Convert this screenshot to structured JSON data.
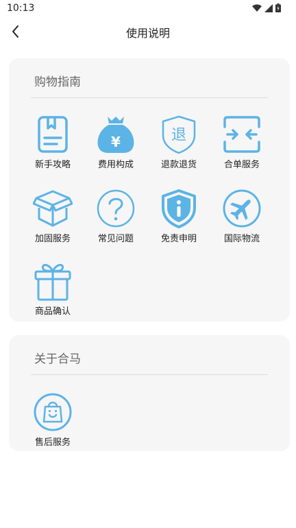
{
  "status_bar": {
    "time": "10:13"
  },
  "header": {
    "title": "使用说明"
  },
  "colors": {
    "accent": "#5cb3e6",
    "card_bg": "#f6f6f6"
  },
  "sections": [
    {
      "title": "购物指南",
      "items": [
        {
          "label": "新手攻略",
          "icon": "guide-book-icon"
        },
        {
          "label": "费用构成",
          "icon": "money-bag-icon"
        },
        {
          "label": "退款退货",
          "icon": "refund-shield-icon"
        },
        {
          "label": "合单服务",
          "icon": "merge-order-icon"
        },
        {
          "label": "加固服务",
          "icon": "package-box-icon"
        },
        {
          "label": "常见问题",
          "icon": "question-icon"
        },
        {
          "label": "免责申明",
          "icon": "info-shield-icon"
        },
        {
          "label": "国际物流",
          "icon": "airplane-icon"
        },
        {
          "label": "商品确认",
          "icon": "gift-icon"
        }
      ]
    },
    {
      "title": "关于合马",
      "items": [
        {
          "label": "售后服务",
          "icon": "shopping-bag-icon"
        }
      ]
    }
  ]
}
